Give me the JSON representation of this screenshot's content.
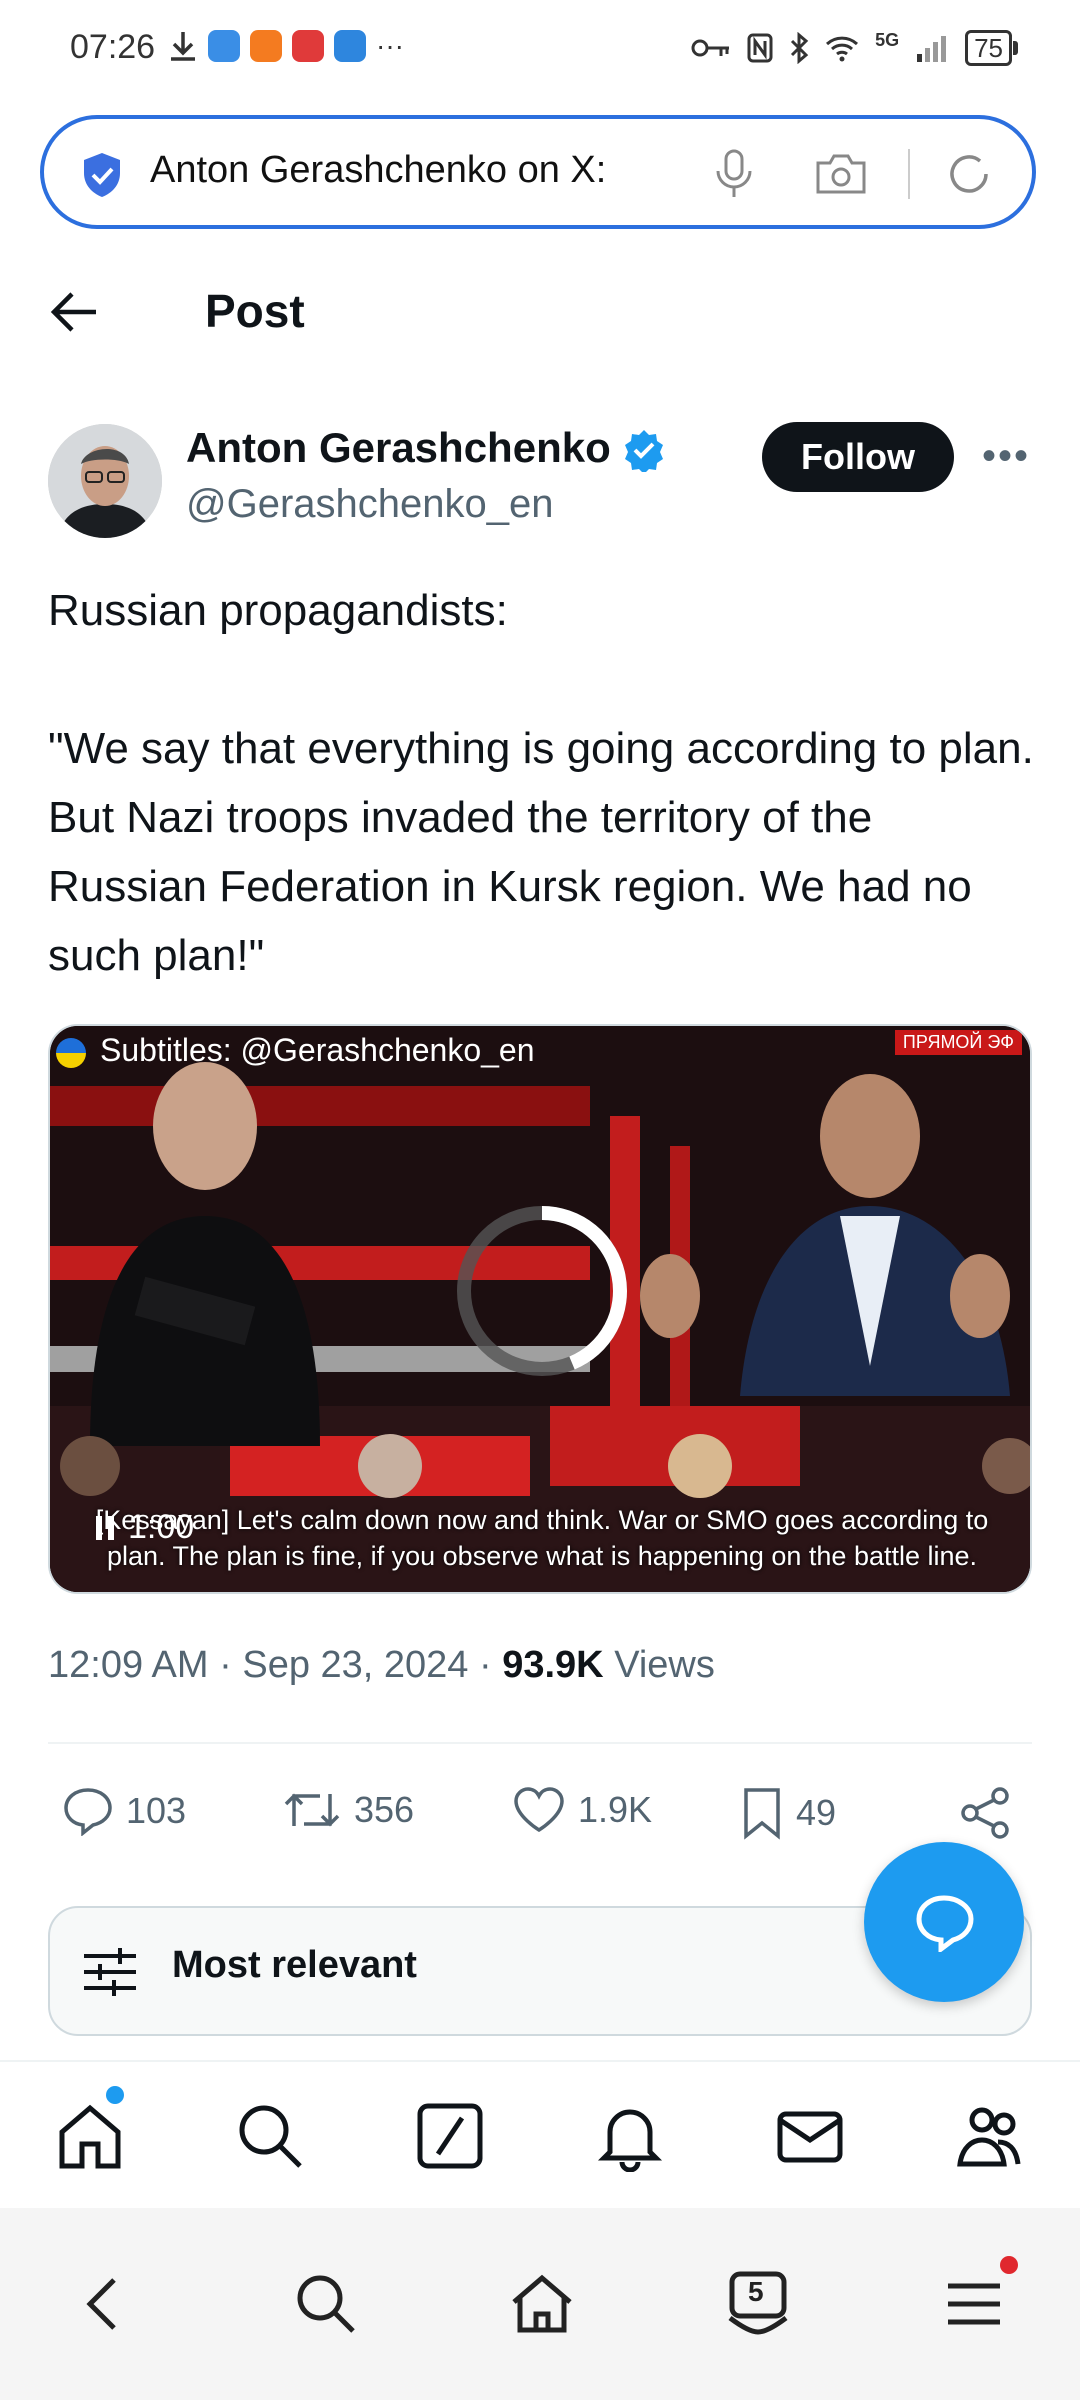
{
  "status_bar": {
    "time": "07:26",
    "network": "5G",
    "battery": "75"
  },
  "browser": {
    "address_text": "Anton Gerashchenko on X:",
    "tabs_count": "5"
  },
  "header": {
    "title": "Post"
  },
  "author": {
    "name": "Anton Gerashchenko",
    "handle": "@Gerashchenko_en",
    "follow_label": "Follow",
    "verified": true
  },
  "tweet": {
    "text": "Russian propagandists:\n\n\"We say that everything is going according to plan. But Nazi troops invaded the territory of the Russian Federation in Kursk region. We had no such plan!\""
  },
  "video": {
    "subtitle_credit": "Subtitles: @Gerashchenko_en",
    "live_badge": "ПРЯМОЙ ЭФ",
    "caption_line1": "[Kessayan] Let's calm down now and think. War or SMO goes according to",
    "caption_line2": "plan. The plan is fine, if you observe what is happening on the battle line.",
    "duration": "1:00",
    "state": "paused-loading"
  },
  "meta": {
    "time": "12:09 AM",
    "date": "Sep 23, 2024",
    "views_count": "93.9K",
    "views_label": "Views"
  },
  "actions": {
    "replies": "103",
    "reposts": "356",
    "likes": "1.9K",
    "bookmarks": "49"
  },
  "replies_sort": {
    "label": "Most relevant"
  },
  "colors": {
    "accent": "#1d9bf0",
    "address_border": "#2c6fde",
    "text_primary": "#0f1419",
    "text_secondary": "#536471",
    "notification_dot": "#1d9bf0",
    "menu_dot": "#e0282e"
  },
  "bottom_nav": [
    "home-icon",
    "search-icon",
    "grok-icon",
    "notifications-icon",
    "messages-icon",
    "communities-icon"
  ],
  "browser_nav": [
    "back-icon",
    "search-icon",
    "home-icon",
    "tabs-icon",
    "menu-icon"
  ]
}
